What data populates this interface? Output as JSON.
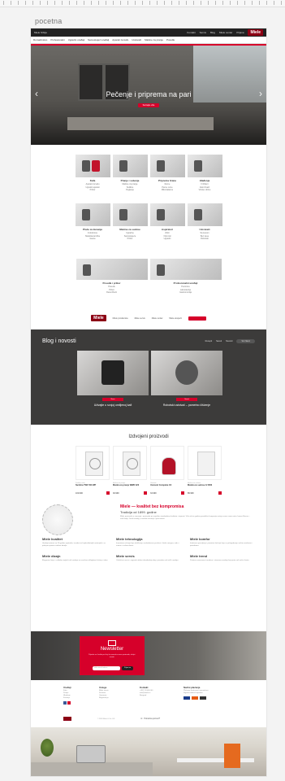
{
  "canvas": {
    "page_label": "pocetna"
  },
  "site": {
    "logo": "Miele",
    "topbar": {
      "left": "Miele Srbija",
      "links": [
        "Kontakt",
        "Servis",
        "Blog",
        "Miele centar",
        "Prijava"
      ]
    },
    "nav": [
      "Domaćinstvo",
      "Profesionalni",
      "Ugradni uređaji",
      "Samostojeći uređaji",
      "Aparati za kafu",
      "Usisivači",
      "Mašine za pranje",
      "Posuđe"
    ],
    "hero": {
      "title": "Pečenje i priprema na pari",
      "cta": "Saznajte više"
    },
    "categories": [
      {
        "title": "Kafa",
        "links": [
          "Aparati za kafu",
          "Ugradni aparati",
          "Pribor"
        ]
      },
      {
        "title": "Pranje i sušenje",
        "links": [
          "Mašine za pranje",
          "Sušilice",
          "Peglanje"
        ]
      },
      {
        "title": "Priprema hrane",
        "links": [
          "Rerne",
          "Parne rerne",
          "Mikrotalasne"
        ]
      },
      {
        "title": "Hlađenje",
        "links": [
          "Frižideri",
          "Zamrzivači",
          "Vinske vitrine"
        ]
      },
      {
        "title": "Ploče za kuvanje",
        "links": [
          "Indukcione",
          "Staklokeramičke",
          "Gasne"
        ]
      },
      {
        "title": "Mašine za sudove",
        "links": [
          "Ugradne",
          "Samostojeće",
          "Pribor"
        ]
      },
      {
        "title": "Aspiratori",
        "links": [
          "Zidni",
          "Ostrvski",
          "Ugradni"
        ]
      },
      {
        "title": "Usisivači",
        "links": [
          "Sa kesom",
          "Bez kese",
          "Robotski"
        ]
      },
      {
        "title": "Posuđe i pribor",
        "links": [
          "Posuđe",
          "Pribor",
          "Deterdženti"
        ]
      },
      {
        "title": "Profesionalni uređaji",
        "links": [
          "Perionice",
          "Laboratorije",
          "Gastronomija"
        ]
      }
    ],
    "category_footer_links": [
      "Miele prodavnica",
      "Miele servis",
      "Miele centar",
      "Miele eksperti"
    ],
    "blog": {
      "title": "Blog i novosti",
      "tabs": [
        "Recepti",
        "Saveti",
        "Novosti",
        "Svi članci"
      ],
      "cards": [
        {
          "badge": "Novo",
          "title": "Uživajte u svojoj omiljenoj kafi"
        },
        {
          "badge": "Saveti",
          "title": "Robotski usisivač – pametno čišćenje"
        }
      ]
    },
    "featured": {
      "title": "Izdvojeni proizvodi",
      "products": [
        {
          "type": "Sušilica veša",
          "name": "Sušilica TWF 500 WP",
          "price": "119.990"
        },
        {
          "type": "Mašina za pranje",
          "name": "Mašina za pranje WWD 320",
          "price": "94.990"
        },
        {
          "type": "Usisivač",
          "name": "Usisivač Complete C3",
          "price": "34.990"
        },
        {
          "type": "Mašina za sudove",
          "name": "Mašina za sudove G 5000",
          "price": "89.990"
        }
      ]
    },
    "about": {
      "headline": "Miele — kvalitet bez kompromisa",
      "subline": "Tradicija od 1899. godine",
      "paragraph": "Miele proizvodi se razvijaju i proizvode po najvišim standardima kvaliteta i trajnosti. Više od sto godina porodična kompanija ostaje verna svom motu: Immer Besser – uvek bolje. Svaki uređaj je rezultat inovacija i preciznosti.",
      "cols": [
        {
          "title": "Miele kvalitet",
          "text": "Uređaji testirani za 20 godina upotrebe, izrađeni od najkvalitetnijih materijala i sa pažnjom prema svakom detalju."
        },
        {
          "title": "Miele tehnologija",
          "text": "Inovativna rešenja koja olakšavaju svakodnevne poslove i štede energiju, vodu i vreme u vašem domu."
        },
        {
          "title": "Miele komfor",
          "text": "Intuitivno upravljanje i pametne funkcije koje se prilagođavaju vašim navikama i potrebama."
        },
        {
          "title": "Miele dizajn",
          "text": "Elegantne linije i usklađen izgled svih uređaja za savršeno uklopljenu kuhinju i dom."
        },
        {
          "title": "Miele servis",
          "text": "Ovlašćeni servis i originalni delovi obezbeđuju dug i pouzdan rad vaših uređaja."
        },
        {
          "title": "Miele trend",
          "text": "Pratimo savremene trendove i stvaramo uređaje koji prate vaš način života."
        }
      ]
    },
    "newsletter": {
      "title": "Newsletter",
      "description": "Prijavite se i budite prvi koji će saznati za nove proizvode, akcije i savete.",
      "placeholder": "Vaša email adresa",
      "button": "Prijavi se"
    },
    "footer": {
      "cols": [
        {
          "title": "Uređaji",
          "items": [
            "Kafa",
            "Pranje",
            "Hlađenje",
            "Kuvanje",
            "Usisivači"
          ]
        },
        {
          "title": "Usluge",
          "items": [
            "Miele servis",
            "Dostava",
            "Garancija",
            "Registracija"
          ]
        },
        {
          "title": "Kontakt",
          "items": [
            "+381 11 000 000",
            "info@miele.rs",
            "Beograd"
          ]
        },
        {
          "title": "Načini plaćanja",
          "items": [
            "Plaćanje karticama i pouzećem.",
            "Sigurna online kupovina."
          ]
        }
      ],
      "copyright": "© 2018 Miele & Cie. KG",
      "help_label": "Potrebna pomoć?"
    }
  }
}
